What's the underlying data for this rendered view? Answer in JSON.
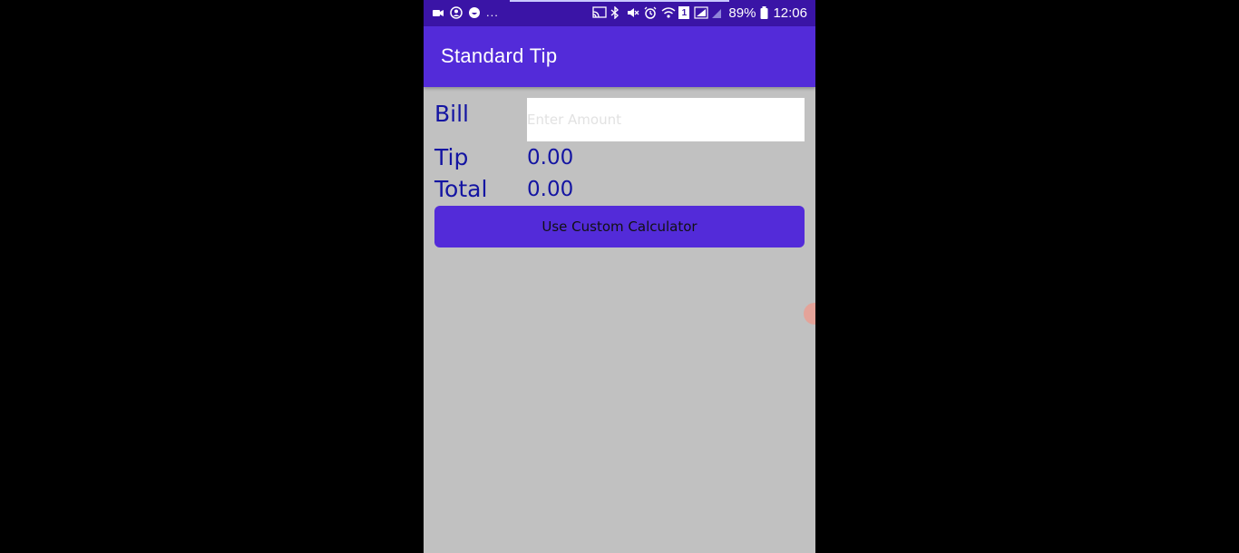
{
  "status_bar": {
    "left_more": "...",
    "battery_percent": "89%",
    "time": "12:06",
    "sim_badge": "1",
    "icons": [
      "video-camera-icon",
      "account-icon",
      "emoji-icon",
      "cast-icon",
      "bluetooth-icon",
      "mute-icon",
      "alarm-icon",
      "wifi-icon",
      "signal-icon",
      "signal-icon",
      "battery-icon"
    ]
  },
  "app_bar": {
    "title": "Standard Tip"
  },
  "form": {
    "bill_label": "Bill",
    "bill_placeholder": "Enter Amount",
    "bill_value": "",
    "tip_label": "Tip",
    "tip_value": "0.00",
    "total_label": "Total",
    "total_value": "0.00",
    "custom_button_label": "Use Custom Calculator"
  },
  "colors": {
    "status_bar": "#3a14a6",
    "app_bar": "#532bd9",
    "button": "#532bd9",
    "text_blue": "#1415a2",
    "background": "#c1c1c1"
  }
}
